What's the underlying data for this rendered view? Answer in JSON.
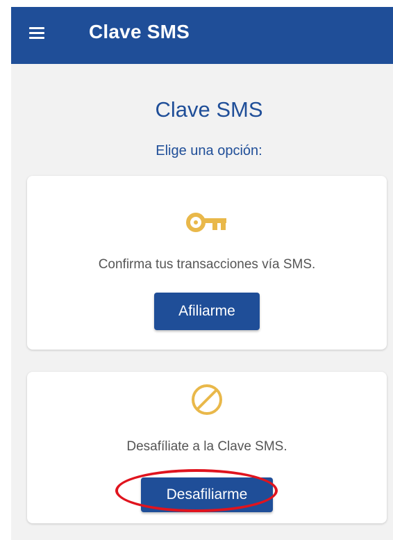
{
  "appbar": {
    "title": "Clave SMS",
    "menu_icon": "hamburger-menu-icon",
    "background": "#1f4e98"
  },
  "page": {
    "title": "Clave SMS",
    "subtitle": "Elige una opción:"
  },
  "cards": [
    {
      "icon": "key-icon",
      "icon_color": "#e9b84a",
      "text": "Confirma tus transacciones vía SMS.",
      "button_label": "Afiliarme"
    },
    {
      "icon": "prohibited-icon",
      "icon_color": "#e9b84a",
      "text": "Desafíliate a la Clave SMS.",
      "button_label": "Desafiliarme"
    }
  ],
  "annotation": {
    "highlight_color": "#e0141e"
  }
}
